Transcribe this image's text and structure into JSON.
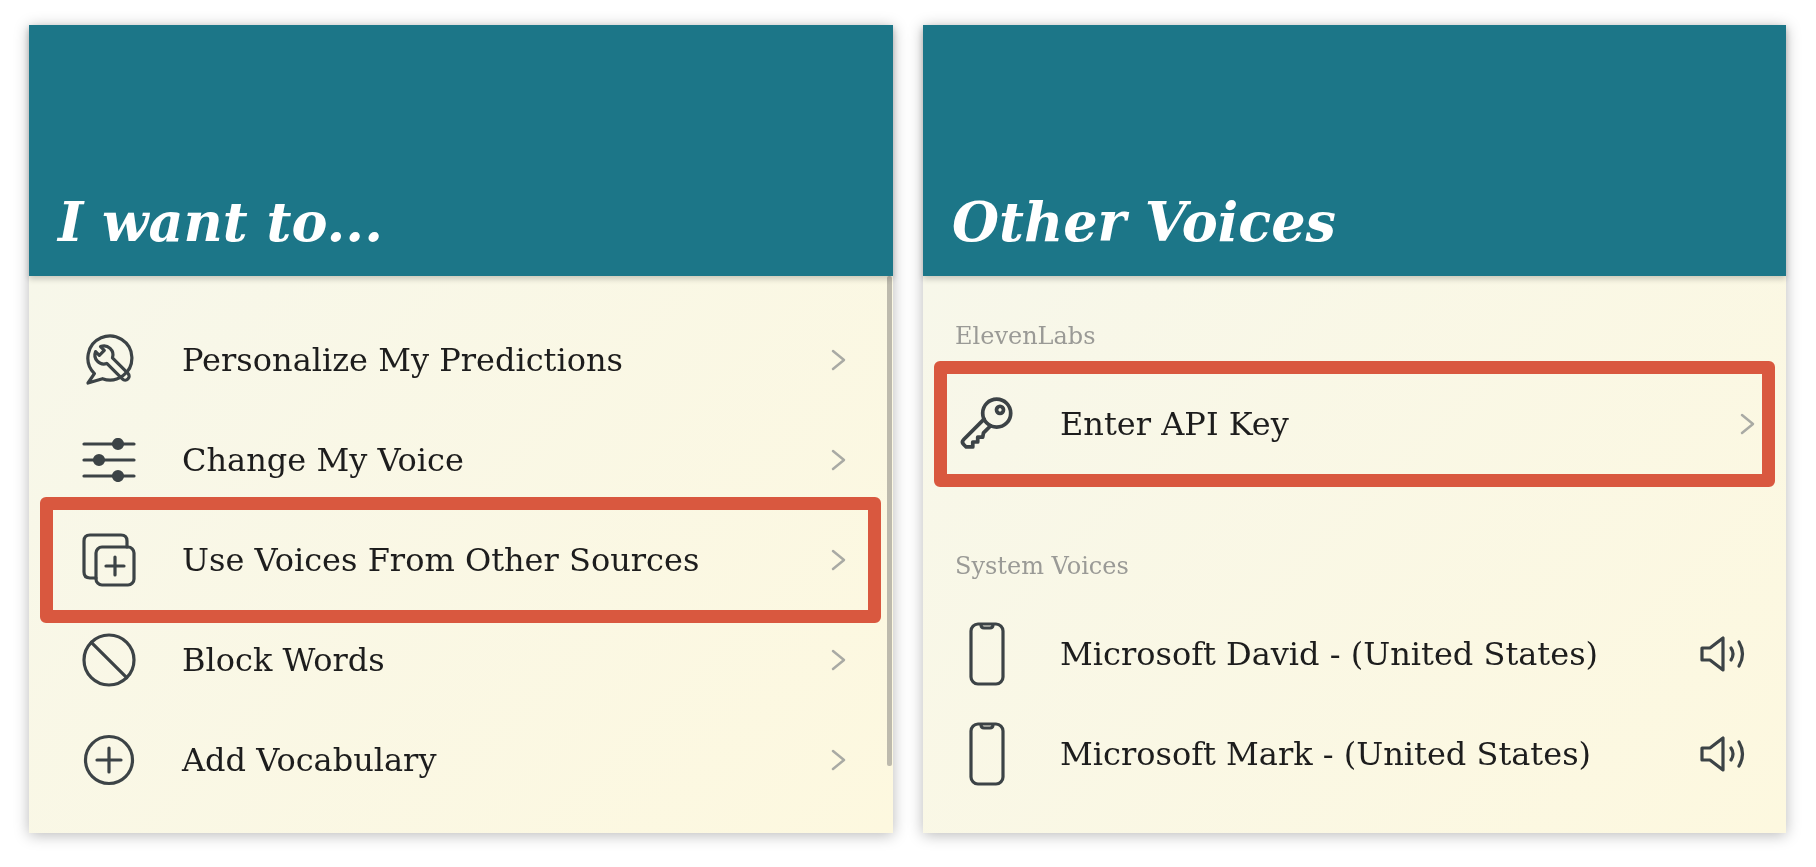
{
  "panels": [
    {
      "title": "I want to...",
      "sections": [
        {
          "items": [
            {
              "kind": "nav",
              "label": "Personalize My Predictions",
              "highlighted": false
            },
            {
              "kind": "nav",
              "label": "Change My Voice",
              "highlighted": false
            },
            {
              "kind": "nav",
              "label": "Use Voices From Other Sources",
              "highlighted": true
            },
            {
              "kind": "nav",
              "label": "Block Words",
              "highlighted": false
            },
            {
              "kind": "nav",
              "label": "Add Vocabulary",
              "highlighted": false
            }
          ]
        }
      ]
    },
    {
      "title": "Other Voices",
      "sections": [
        {
          "heading": "ElevenLabs",
          "items": [
            {
              "kind": "nav",
              "label": "Enter API Key",
              "highlighted": true
            }
          ]
        },
        {
          "heading": "System Voices",
          "items": [
            {
              "kind": "voice",
              "label": "Microsoft David - (United States)",
              "highlighted": false
            },
            {
              "kind": "voice",
              "label": "Microsoft Mark - (United States)",
              "highlighted": false
            }
          ]
        }
      ]
    }
  ]
}
